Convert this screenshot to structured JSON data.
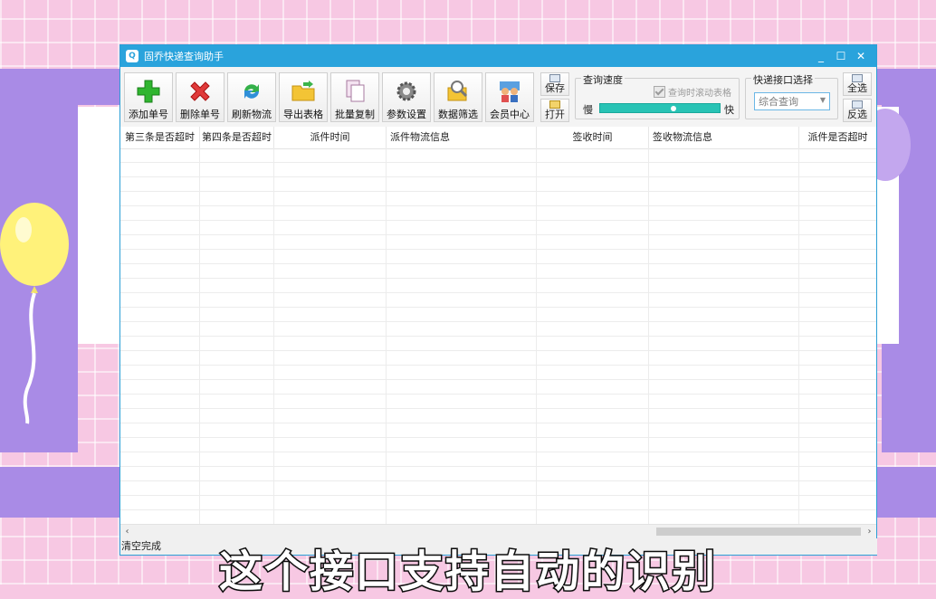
{
  "window": {
    "title": "固乔快递查询助手",
    "icon": "Q"
  },
  "titlebar_controls": {
    "minimize": "_",
    "maximize": "☐",
    "close": "✕"
  },
  "toolbar": [
    {
      "label": "添加单号",
      "icon": "plus-icon"
    },
    {
      "label": "删除单号",
      "icon": "delete-x-icon"
    },
    {
      "label": "刷新物流",
      "icon": "refresh-icon"
    },
    {
      "label": "导出表格",
      "icon": "folder-export-icon"
    },
    {
      "label": "批量复制",
      "icon": "copy-icon"
    },
    {
      "label": "参数设置",
      "icon": "gear-icon"
    },
    {
      "label": "数据筛选",
      "icon": "magnifier-icon"
    },
    {
      "label": "会员中心",
      "icon": "members-icon"
    }
  ],
  "file_buttons": {
    "save": "保存",
    "open": "打开"
  },
  "speed_group": {
    "title": "查询速度",
    "scroll_checkbox": "查询时滚动表格",
    "slow": "慢",
    "fast": "快",
    "slider_value_fraction": 0.62
  },
  "interface_group": {
    "title": "快递接口选择",
    "selected": "综合查询"
  },
  "select_buttons": {
    "select_all": "全选",
    "invert": "反选"
  },
  "table": {
    "columns": [
      "第三条是否超时",
      "第四条是否超时",
      "派件时间",
      "派件物流信息",
      "签收时间",
      "签收物流信息",
      "派件是否超时"
    ]
  },
  "status": {
    "text": "清空完成"
  },
  "subtitle": "这个接口支持自动的识别",
  "colors": {
    "titlebar": "#2aa3dc",
    "slider": "#28c3b5",
    "bg_pink": "#f7c8e3",
    "bg_purple": "#a98be6"
  }
}
